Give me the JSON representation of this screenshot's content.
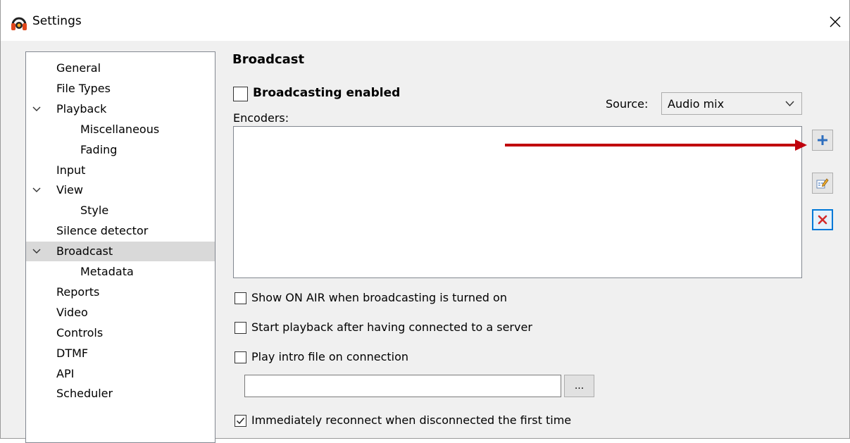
{
  "window": {
    "title": "Settings",
    "close_glyph": "✕"
  },
  "nav": {
    "items": [
      {
        "label": "General",
        "level": 0,
        "expandable": false,
        "selected": false
      },
      {
        "label": "File Types",
        "level": 0,
        "expandable": false,
        "selected": false
      },
      {
        "label": "Playback",
        "level": 0,
        "expandable": true,
        "selected": false
      },
      {
        "label": "Miscellaneous",
        "level": 1,
        "expandable": false,
        "selected": false
      },
      {
        "label": "Fading",
        "level": 1,
        "expandable": false,
        "selected": false
      },
      {
        "label": "Input",
        "level": 0,
        "expandable": false,
        "selected": false
      },
      {
        "label": "View",
        "level": 0,
        "expandable": true,
        "selected": false
      },
      {
        "label": "Style",
        "level": 1,
        "expandable": false,
        "selected": false
      },
      {
        "label": "Silence detector",
        "level": 0,
        "expandable": false,
        "selected": false
      },
      {
        "label": "Broadcast",
        "level": 0,
        "expandable": true,
        "selected": true
      },
      {
        "label": "Metadata",
        "level": 1,
        "expandable": false,
        "selected": false
      },
      {
        "label": "Reports",
        "level": 0,
        "expandable": false,
        "selected": false
      },
      {
        "label": "Video",
        "level": 0,
        "expandable": false,
        "selected": false
      },
      {
        "label": "Controls",
        "level": 0,
        "expandable": false,
        "selected": false
      },
      {
        "label": "DTMF",
        "level": 0,
        "expandable": false,
        "selected": false
      },
      {
        "label": "API",
        "level": 0,
        "expandable": false,
        "selected": false
      },
      {
        "label": "Scheduler",
        "level": 0,
        "expandable": false,
        "selected": false
      }
    ]
  },
  "panel": {
    "heading": "Broadcast",
    "broadcasting_enabled": {
      "label": "Broadcasting enabled",
      "checked": false
    },
    "encoders_label": "Encoders:",
    "source": {
      "label": "Source:",
      "value": "Audio mix"
    },
    "buttons": {
      "add_icon": "plus-icon",
      "edit_icon": "edit-icon",
      "remove_icon": "delete-icon"
    },
    "options": [
      {
        "label": "Show ON AIR when broadcasting is turned on",
        "checked": false
      },
      {
        "label": "Start playback after having connected to a server",
        "checked": false
      },
      {
        "label": "Play intro file on connection",
        "checked": false
      }
    ],
    "intro_file": {
      "value": "",
      "browse_label": "..."
    },
    "reconnect": {
      "label": "Immediately reconnect when disconnected the first time",
      "checked": true
    }
  },
  "colors": {
    "annotation_arrow": "#c0000c",
    "selection": "#d9d9d9",
    "focus_border": "#0078d7",
    "plus": "#2f6fbf",
    "delete": "#d42a2a"
  }
}
